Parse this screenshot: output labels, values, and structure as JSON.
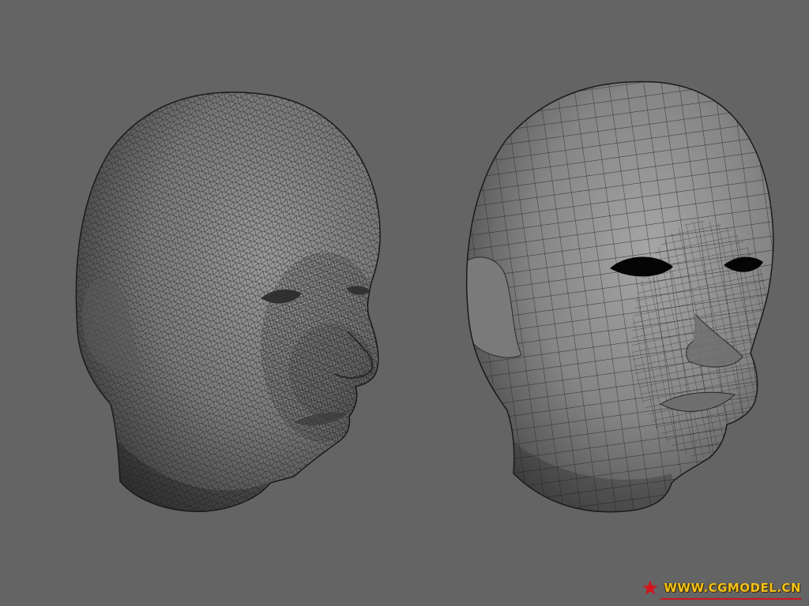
{
  "scene": {
    "background_color": "#646464",
    "mesh_color": "#2b2b2b",
    "surface_color": "#8a8a8a",
    "heads": [
      {
        "name": "dense-triangulated-head",
        "mesh_density": "high"
      },
      {
        "name": "quad-topology-head",
        "mesh_density": "low"
      }
    ]
  },
  "watermark": {
    "text": "WWW.CGMODEL.CN",
    "text_color": "#f3c21a",
    "star_color": "#d4141c",
    "underline_color": "#c8161d"
  }
}
